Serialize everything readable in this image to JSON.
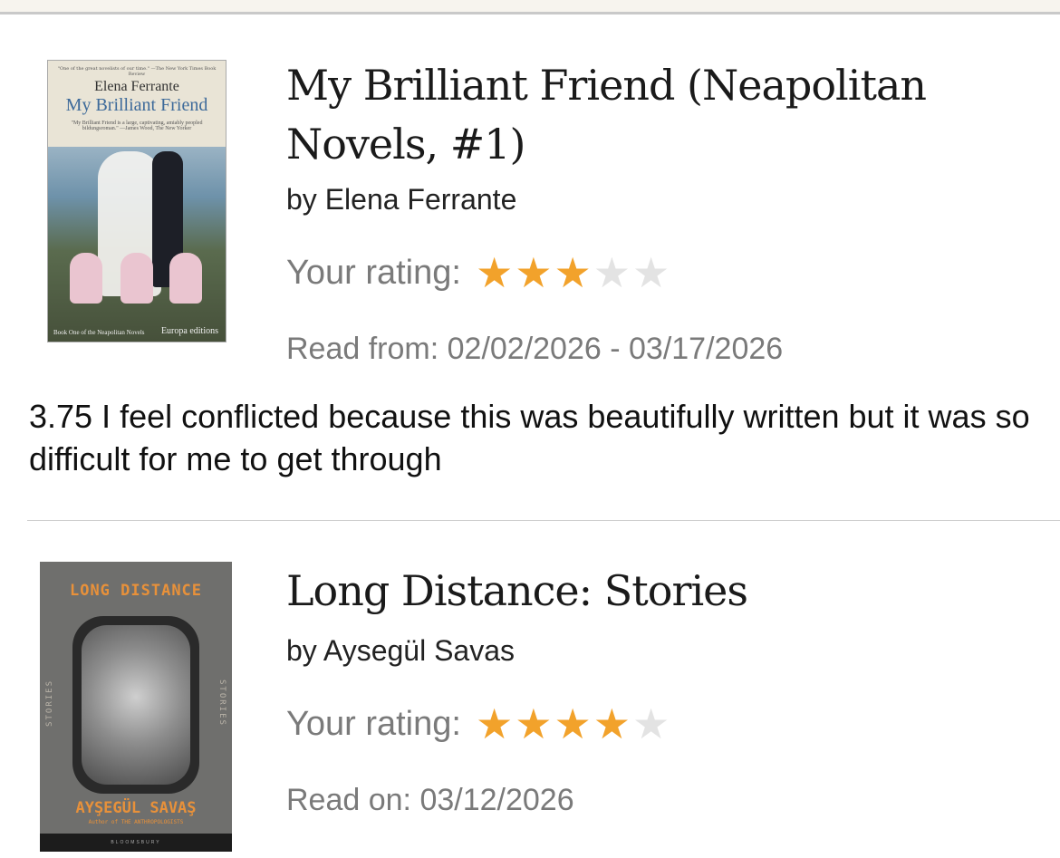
{
  "colors": {
    "star_filled": "#f2a22b",
    "star_empty": "#e3e3e3",
    "muted_text": "#7a7a7a"
  },
  "books": [
    {
      "title": "My Brilliant Friend (Neapolitan Novels, #1)",
      "author": "by Elena Ferrante",
      "rating_label": "Your rating:",
      "rating": 3,
      "rating_max": 5,
      "read_text": "Read from: 02/02/2026 - 03/17/2026",
      "review": "3.75 I feel conflicted because this was beautifully written but it was so difficult for me to get through",
      "cover": {
        "blurb_top": "\"One of the great novelists of our time.\" —The New York Times Book Review",
        "author": "Elena Ferrante",
        "title": "My Brilliant Friend",
        "quote": "\"My Brilliant Friend is a large, captivating, amiably peopled bildungsroman.\" —James Wood, The New Yorker",
        "series": "Book One of the Neapolitan Novels",
        "publisher": "Europa editions"
      }
    },
    {
      "title": "Long Distance: Stories",
      "author": "by Aysegül Savas",
      "rating_label": "Your rating:",
      "rating": 4,
      "rating_max": 5,
      "read_text": "Read on: 03/12/2026",
      "cover": {
        "title": "LONG DISTANCE",
        "side_left": "STORIES",
        "side_right": "STORIES",
        "author": "AYŞEGÜL SAVAŞ",
        "subtitle": "Author of THE ANTHROPOLOGISTS",
        "publisher": "BLOOMSBURY"
      }
    }
  ]
}
